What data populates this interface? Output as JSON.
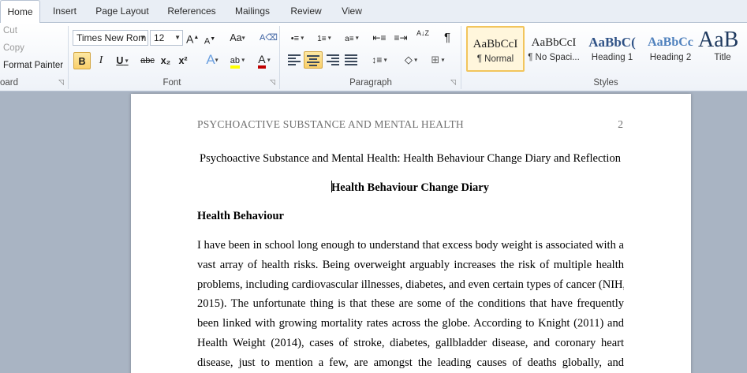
{
  "tabs": [
    {
      "label": "Home",
      "active": true
    },
    {
      "label": "Insert",
      "active": false
    },
    {
      "label": "Page Layout",
      "active": false
    },
    {
      "label": "References",
      "active": false
    },
    {
      "label": "Mailings",
      "active": false
    },
    {
      "label": "Review",
      "active": false
    },
    {
      "label": "View",
      "active": false
    }
  ],
  "clipboard": {
    "cut": "Cut",
    "copy": "Copy",
    "format_painter": "Format Painter",
    "group_label": "oard"
  },
  "font": {
    "family": "Times New Rom",
    "size": "12",
    "grow_label": "A",
    "shrink_label": "A",
    "change_case": "Aa",
    "bold": "B",
    "italic": "I",
    "underline": "U",
    "strikethrough": "abc",
    "subscript": "x₂",
    "superscript": "x²",
    "text_effects": "A",
    "highlight": "ab",
    "font_color": "A",
    "group_label": "Font",
    "highlight_color": "#ffff00",
    "font_color_value": "#c00000"
  },
  "paragraph": {
    "sort": "A↓Z",
    "pilcrow": "¶",
    "group_label": "Paragraph"
  },
  "styles": {
    "group_label": "Styles",
    "items": [
      {
        "sample": "AaBbCcI",
        "name": "¶ Normal",
        "selected": true
      },
      {
        "sample": "AaBbCcI",
        "name": "¶ No Spaci...",
        "selected": false
      },
      {
        "sample": "AaBbC(",
        "name": "Heading 1",
        "selected": false
      },
      {
        "sample": "AaBbCc",
        "name": "Heading 2",
        "selected": false
      },
      {
        "sample": "AaB",
        "name": "Title",
        "selected": false
      }
    ]
  },
  "document": {
    "running_head": "PSYCHOACTIVE SUBSTANCE AND MENTAL HEALTH",
    "page_number": "2",
    "title": "Psychoactive Substance and Mental Health: Health Behaviour Change Diary and Reflection",
    "heading": "Health Behaviour Change Diary",
    "section_heading": "Health Behaviour",
    "body_lines": [
      "I have been in school long enough to understand that excess body weight is associated with a",
      "vast array of health risks. Being overweight arguably increases the risk of multiple health",
      "problems, including cardiovascular illnesses, diabetes, and even certain types of cancer (NIH,",
      "2015). The unfortunate thing is that these are some of the conditions that have frequently",
      "been linked with growing mortality rates across the globe. According to Knight (2011) and",
      "Health Weight (2014), cases of stroke, diabetes, gallbladder disease, and coronary heart",
      "disease, just to mention a few, are amongst the leading causes of deaths globally, and"
    ]
  }
}
